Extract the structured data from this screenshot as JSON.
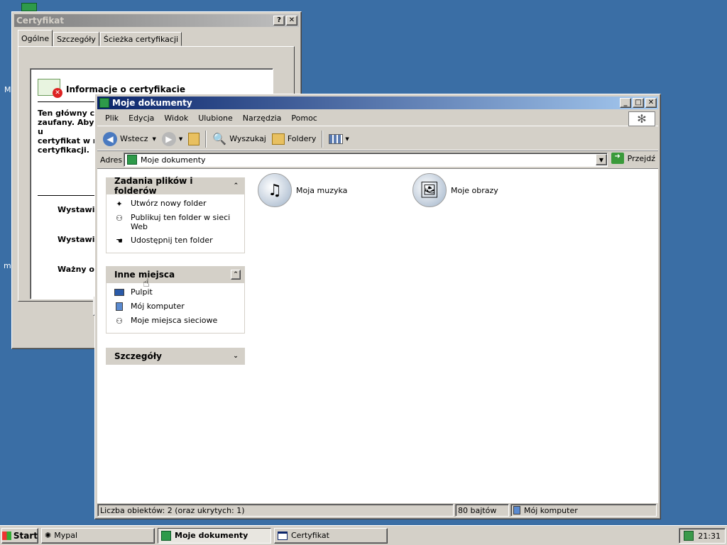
{
  "colors": {
    "desktop": "#3a6ea5",
    "title_active_start": "#0a246a",
    "title_active_end": "#a6caf0",
    "face": "#d4d0c8"
  },
  "desktop": {
    "icons": [
      {
        "label": "M"
      },
      {
        "label": "my"
      }
    ]
  },
  "cert_window": {
    "title": "Certyfikat",
    "help_icon": "help-icon",
    "close_icon": "close-icon",
    "tabs": [
      {
        "label": "Ogólne",
        "active": true
      },
      {
        "label": "Szczegóły",
        "active": false
      },
      {
        "label": "Ścieżka certyfikacji",
        "active": false
      }
    ],
    "info_title": "Informacje o certyfikacie",
    "body_lines": [
      "Ten główny ce",
      "zaufany. Aby u",
      "certyfikat w n",
      "certyfikacji."
    ],
    "issued_to_label": "Wystawic",
    "issued_by_label": "Wystawic",
    "valid_label": "Ważny od"
  },
  "explorer": {
    "title": "Moje dokumenty",
    "menu": [
      "Plik",
      "Edycja",
      "Widok",
      "Ulubione",
      "Narzędzia",
      "Pomoc"
    ],
    "toolbar": {
      "back_label": "Wstecz",
      "search_label": "Wyszukaj",
      "folders_label": "Foldery"
    },
    "address": {
      "label": "Adres",
      "value": "Moje dokumenty",
      "go_label": "Przejdź"
    },
    "tasks": {
      "header": "Zadania plików i folderów",
      "items": [
        {
          "label": "Utwórz nowy folder",
          "icon": "new-folder-icon"
        },
        {
          "label": "Publikuj ten folder w sieci Web",
          "icon": "publish-web-icon"
        },
        {
          "label": "Udostępnij ten folder",
          "icon": "share-folder-icon"
        }
      ]
    },
    "places": {
      "header": "Inne miejsca",
      "items": [
        {
          "label": "Pulpit",
          "icon": "desktop-icon"
        },
        {
          "label": "Mój komputer",
          "icon": "my-computer-icon"
        },
        {
          "label": "Moje miejsca sieciowe",
          "icon": "network-places-icon"
        }
      ]
    },
    "details": {
      "header": "Szczegóły"
    },
    "folders": [
      {
        "label": "Moja muzyka",
        "icon": "music-folder-icon"
      },
      {
        "label": "Moje obrazy",
        "icon": "pictures-folder-icon"
      }
    ],
    "status": {
      "count": "Liczba obiektów: 2 (oraz ukrytych: 1)",
      "size": "80 bajtów",
      "zone": "Mój komputer"
    }
  },
  "taskbar": {
    "start_label": "Start",
    "tasks": [
      {
        "label": "Mypal",
        "pressed": false
      },
      {
        "label": "Moje dokumenty",
        "pressed": true
      },
      {
        "label": "Certyfikat",
        "pressed": false
      }
    ],
    "clock": "21:31"
  }
}
